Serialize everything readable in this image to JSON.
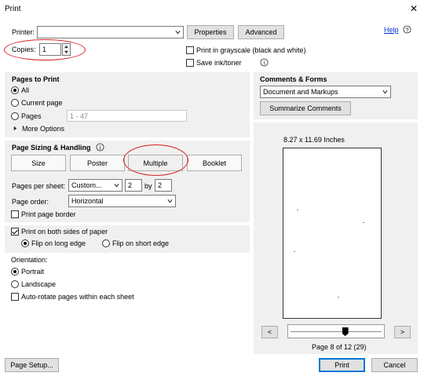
{
  "window": {
    "title": "Print",
    "close_glyph": "✕"
  },
  "printer": {
    "label": "Printer:",
    "value": "",
    "properties": "Properties",
    "advanced": "Advanced",
    "help": "Help"
  },
  "copies": {
    "label": "Copies:",
    "value": "1"
  },
  "options": {
    "grayscale": "Print in grayscale (black and white)",
    "save_ink": "Save ink/toner"
  },
  "pages_to_print": {
    "title": "Pages to Print",
    "all": "All",
    "current": "Current page",
    "pages": "Pages",
    "pages_range": "1 - 47",
    "more": "More Options"
  },
  "page_sizing": {
    "title": "Page Sizing & Handling",
    "tabs": [
      "Size",
      "Poster",
      "Multiple",
      "Booklet"
    ],
    "active_tab": "Multiple",
    "pages_per_sheet_label": "Pages per sheet:",
    "pages_per_sheet_value": "Custom...",
    "cols": "2",
    "by": "by",
    "rows": "2",
    "page_order_label": "Page order:",
    "page_order_value": "Horizontal",
    "border": "Print page border"
  },
  "duplex": {
    "both_sides": "Print on both sides of paper",
    "long_edge": "Flip on long edge",
    "short_edge": "Flip on short edge"
  },
  "orientation": {
    "title": "Orientation:",
    "portrait": "Portrait",
    "landscape": "Landscape",
    "auto_rotate": "Auto-rotate pages within each sheet"
  },
  "comments": {
    "title": "Comments & Forms",
    "value": "Document and Markups",
    "summarize": "Summarize Comments"
  },
  "preview": {
    "size": "8.27 x 11.69 Inches",
    "page_info": "Page 8 of 12 (29)",
    "prev": "<",
    "next": ">",
    "slider_fraction": 0.6
  },
  "footer": {
    "page_setup": "Page Setup...",
    "print": "Print",
    "cancel": "Cancel"
  },
  "colors": {
    "accent": "#0078d7",
    "annotation": "#d42020",
    "panel": "#f0f0f0",
    "link": "#0033cc"
  }
}
